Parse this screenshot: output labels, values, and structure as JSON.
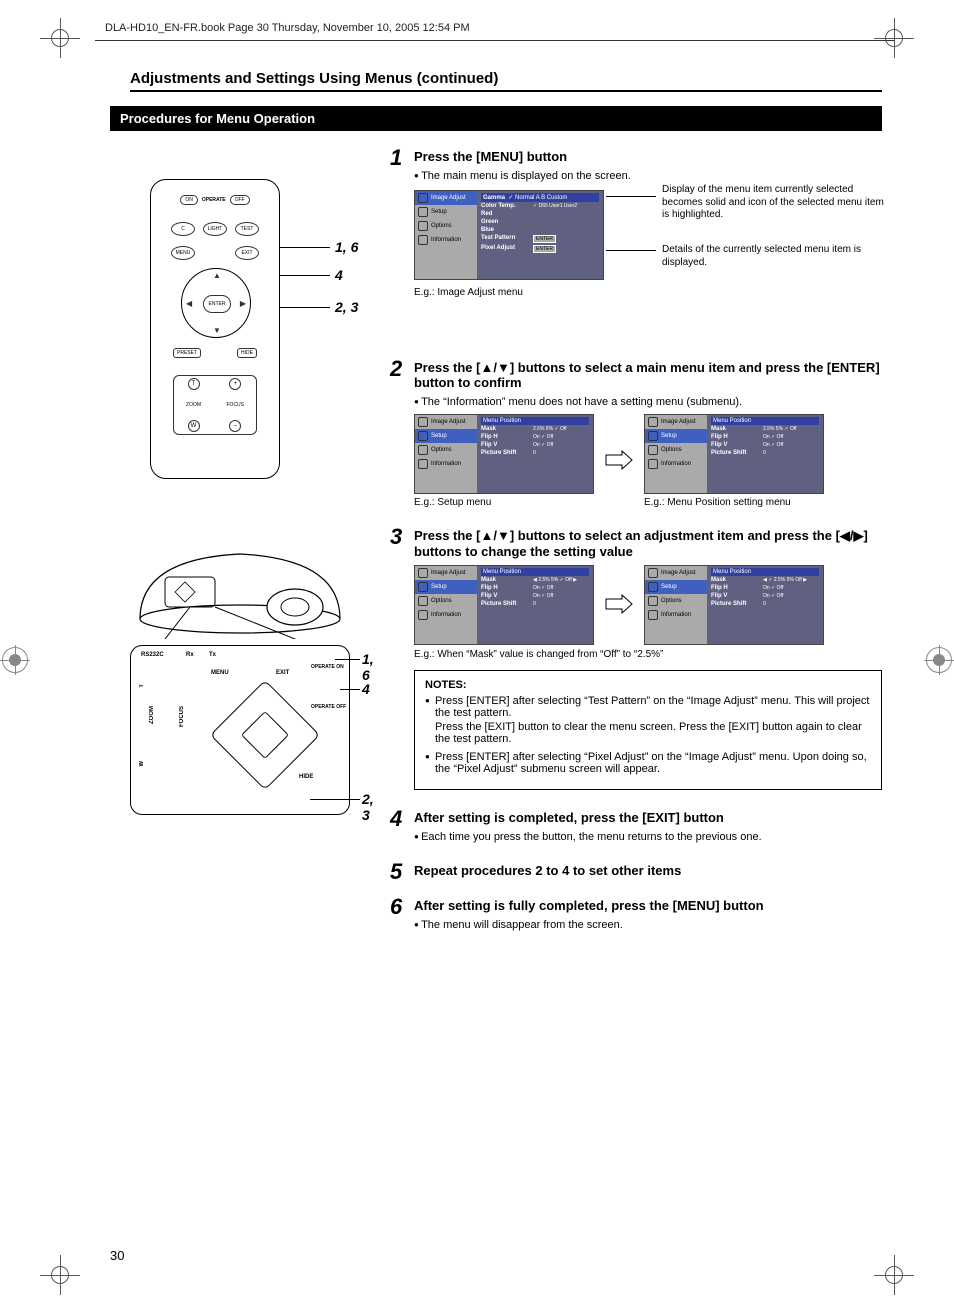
{
  "meta": {
    "header_line": "DLA-HD10_EN-FR.book  Page 30  Thursday, November 10, 2005  12:54 PM",
    "page_number": "30"
  },
  "section_title": "Adjustments and Settings Using Menus (continued)",
  "section_bar": "Procedures for Menu Operation",
  "remote": {
    "operate": "OPERATE",
    "on": "ON",
    "off": "OFF",
    "c": "C",
    "light": "LIGHT",
    "test": "TEST",
    "menu": "MENU",
    "exit": "EXIT",
    "enter": "ENTER",
    "preset": "PRESET",
    "hide": "HIDE",
    "zoom": "ZOOM",
    "focus": "FOCUS",
    "t": "T",
    "w": "W",
    "plus": "+",
    "minus": "–"
  },
  "panel": {
    "rs232c": "RS232C",
    "rx": "Rx",
    "tx": "Tx",
    "menu": "MENU",
    "exit": "EXIT",
    "hide": "HIDE",
    "operate_on": "OPERATE ON",
    "operate_off": "OPERATE OFF",
    "zoom": "ZOOM",
    "focus": "FOCUS",
    "w": "W",
    "t": "T"
  },
  "callouts": {
    "r1": "1, 6",
    "r2": "4",
    "r3": "2, 3",
    "p1": "1, 6",
    "p2": "4",
    "p3": "2, 3"
  },
  "steps": {
    "s1": {
      "title": "Press the [MENU] button",
      "b1": "The main menu is displayed on the screen.",
      "annot1": "Display of the menu item currently selected becomes solid and icon of the selected menu item is highlighted.",
      "annot2": "Details of the currently selected menu item is displayed.",
      "shot_caption": "E.g.: Image Adjust menu",
      "menu": {
        "side": [
          "Image Adjust",
          "Setup",
          "Options",
          "Information"
        ],
        "hdr": "Gamma",
        "hdr_vals": "✓ Normal   A   B   Custom",
        "rows": [
          {
            "k": "Color Temp.",
            "v": "✓ D65   User1   User2"
          },
          {
            "k": "Red",
            "v": ""
          },
          {
            "k": "Green",
            "v": ""
          },
          {
            "k": "Blue",
            "v": ""
          },
          {
            "k": "Test Pattern",
            "v": "ENTER"
          },
          {
            "k": "Pixel Adjust",
            "v": "ENTER"
          }
        ]
      }
    },
    "s2": {
      "title": "Press the [▲/▼] buttons to select a main menu item and press the [ENTER] button to confirm",
      "b1": "The “Information” menu does not have a setting menu (submenu).",
      "left_caption": "E.g.: Setup menu",
      "right_caption": "E.g.: Menu Position setting menu",
      "menu_left": {
        "side": [
          "Image Adjust",
          "Setup",
          "Options",
          "Information"
        ],
        "hdr": "Menu Position",
        "rows": [
          {
            "k": "Mask",
            "v": "2.5%   5%   ✓ Off"
          },
          {
            "k": "Flip H",
            "v": "On   ✓ Off"
          },
          {
            "k": "Flip V",
            "v": "On   ✓ Off"
          },
          {
            "k": "Picture Shift",
            "v": "0"
          }
        ]
      },
      "menu_right": {
        "side": [
          "Image Adjust",
          "Setup",
          "Options",
          "Information"
        ],
        "hdr": "Menu Position",
        "rows": [
          {
            "k": "Mask",
            "v": "2.5%   5%   ✓ Off"
          },
          {
            "k": "Flip H",
            "v": "On   ✓ Off"
          },
          {
            "k": "Flip V",
            "v": "On   ✓ Off"
          },
          {
            "k": "Picture Shift",
            "v": "0"
          }
        ]
      }
    },
    "s3": {
      "title": "Press the [▲/▼] buttons to select an adjustment item and press the [◀/▶] buttons to change the setting value",
      "caption": "E.g.: When “Mask” value is changed from “Off” to “2.5%”",
      "menu_left": {
        "side": [
          "Image Adjust",
          "Setup",
          "Options",
          "Information"
        ],
        "hdr": "Menu Position",
        "rows": [
          {
            "k": "Mask",
            "v": "◀  2.5%   5%   ✓ Off  ▶"
          },
          {
            "k": "Flip H",
            "v": "On   ✓ Off"
          },
          {
            "k": "Flip V",
            "v": "On   ✓ Off"
          },
          {
            "k": "Picture Shift",
            "v": "0"
          }
        ]
      },
      "menu_right": {
        "side": [
          "Image Adjust",
          "Setup",
          "Options",
          "Information"
        ],
        "hdr": "Menu Position",
        "rows": [
          {
            "k": "Mask",
            "v": "◀  ✓ 2.5%   5%   Off  ▶"
          },
          {
            "k": "Flip H",
            "v": "On   ✓ Off"
          },
          {
            "k": "Flip V",
            "v": "On   ✓ Off"
          },
          {
            "k": "Picture Shift",
            "v": "0"
          }
        ]
      }
    },
    "s4": {
      "title": "After setting is completed, press the [EXIT] button",
      "b1": "Each time you press the button, the menu returns to the previous one."
    },
    "s5": {
      "title": "Repeat procedures 2 to 4 to set other items"
    },
    "s6": {
      "title": "After setting is fully completed, press the [MENU] button",
      "b1": "The menu will disappear from the screen."
    }
  },
  "notes": {
    "title": "NOTES:",
    "n1a": "Press [ENTER] after selecting “Test Pattern” on the “Image Adjust” menu. This will project the test pattern.",
    "n1b": "Press the [EXIT] button to clear the menu screen. Press the [EXIT] button again to clear the test pattern.",
    "n2": "Press [ENTER] after selecting “Pixel Adjust” on the “Image Adjust” menu. Upon doing so, the “Pixel Adjust” submenu screen will appear."
  }
}
